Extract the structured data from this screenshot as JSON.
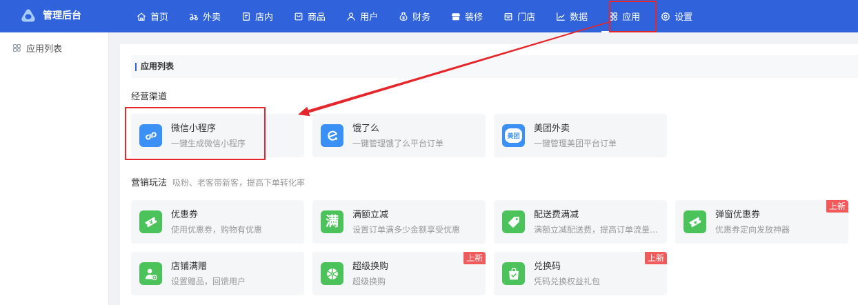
{
  "header": {
    "title": "管理后台",
    "logo_icon": "logo-icon"
  },
  "nav": [
    {
      "label": "首页",
      "icon": "home-icon"
    },
    {
      "label": "外卖",
      "icon": "delivery-icon"
    },
    {
      "label": "店内",
      "icon": "dine-in-icon"
    },
    {
      "label": "商品",
      "icon": "product-icon"
    },
    {
      "label": "用户",
      "icon": "user-icon"
    },
    {
      "label": "财务",
      "icon": "finance-icon"
    },
    {
      "label": "装修",
      "icon": "decoration-icon"
    },
    {
      "label": "门店",
      "icon": "store-icon"
    },
    {
      "label": "数据",
      "icon": "chart-icon"
    },
    {
      "label": "应用",
      "icon": "apps-icon",
      "active": true
    },
    {
      "label": "设置",
      "icon": "gear-icon"
    }
  ],
  "sidebar": {
    "items": [
      {
        "label": "应用列表",
        "icon": "apps-icon"
      }
    ]
  },
  "panel": {
    "title": "应用列表"
  },
  "sections": [
    {
      "title": "经营渠道",
      "apps": [
        {
          "name": "微信小程序",
          "desc": "一键生成微信小程序",
          "icon": "mini-program-icon"
        },
        {
          "name": "饿了么",
          "desc": "一键管理饿了么平台订单",
          "icon": "eleme-icon"
        },
        {
          "name": "美团外卖",
          "desc": "一键管理美团平台订单",
          "icon": "meituan-icon",
          "logo_text": "美团"
        }
      ]
    },
    {
      "title": "营销玩法",
      "subtitle": "吸粉、老客带新客，提高下单转化率",
      "apps": [
        {
          "name": "优惠券",
          "desc": "使用优惠券，购物有优惠",
          "icon": "coupon-icon"
        },
        {
          "name": "满额立减",
          "desc": "设置订单满多少金额享受优惠",
          "icon": "full-reduction-icon",
          "icon_text": "满"
        },
        {
          "name": "配送费满减",
          "desc": "满额立减配送费，提高订单流量…",
          "icon": "delivery-fee-tag-icon"
        },
        {
          "name": "弹窗优惠券",
          "desc": "优惠券定向发放神器",
          "icon": "popup-coupon-icon",
          "badge": "上新"
        },
        {
          "name": "店铺满赠",
          "desc": "设置赠品，回馈用户",
          "icon": "gift-user-icon"
        },
        {
          "name": "超级换购",
          "desc": "超级换购",
          "icon": "exchange-wheel-icon",
          "badge": "上新"
        },
        {
          "name": "兑换码",
          "desc": "凭码兑换权益礼包",
          "icon": "redeem-code-icon",
          "badge": "上新"
        }
      ]
    }
  ],
  "colors": {
    "header": "#2f62db",
    "channel_icon": "#3a90f5",
    "marketing_icon": "#4cc35a",
    "badge": "#f05a5a",
    "annotation": "#e5262a"
  }
}
